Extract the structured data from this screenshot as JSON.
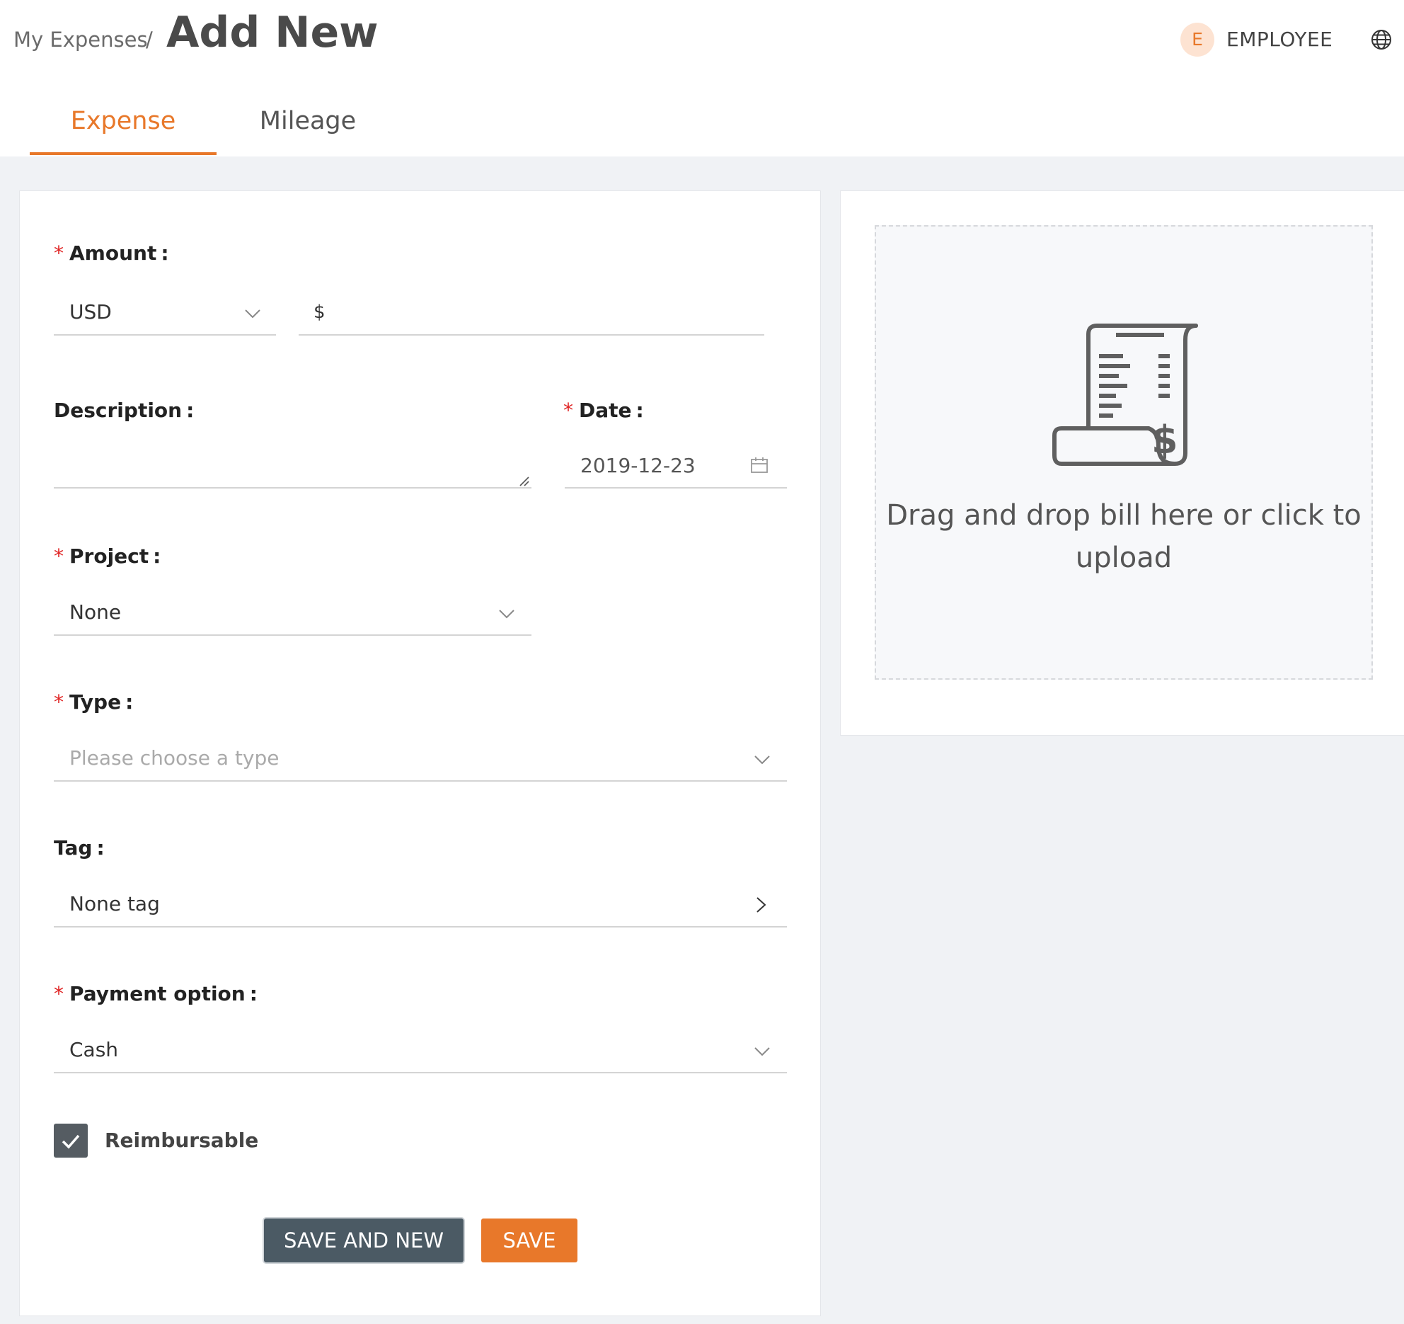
{
  "header": {
    "breadcrumb_parent": "My Expenses",
    "breadcrumb_separator": "/",
    "title": "Add New",
    "user_initial": "E",
    "user_name": "EMPLOYEE"
  },
  "tabs": [
    {
      "label": "Expense",
      "active": true
    },
    {
      "label": "Mileage",
      "active": false
    }
  ],
  "form": {
    "required_mark": "*",
    "amount": {
      "label": "Amount",
      "currency": "USD",
      "currency_symbol": "$",
      "value": ""
    },
    "description": {
      "label": "Description",
      "value": ""
    },
    "date": {
      "label": "Date",
      "value": "2019-12-23"
    },
    "project": {
      "label": "Project",
      "value": "None"
    },
    "type": {
      "label": "Type",
      "placeholder": "Please choose a type"
    },
    "tag": {
      "label": "Tag",
      "value": "None tag"
    },
    "payment": {
      "label": "Payment option",
      "value": "Cash"
    },
    "reimbursable": {
      "label": "Reimbursable",
      "checked": true
    },
    "label_suffix": ":"
  },
  "buttons": {
    "save_and_new": "SAVE AND NEW",
    "save": "SAVE"
  },
  "upload": {
    "text": "Drag and drop bill here or click to upload"
  },
  "colors": {
    "accent": "#e8782a",
    "dark_button": "#4b5a64",
    "required": "#e02424"
  }
}
